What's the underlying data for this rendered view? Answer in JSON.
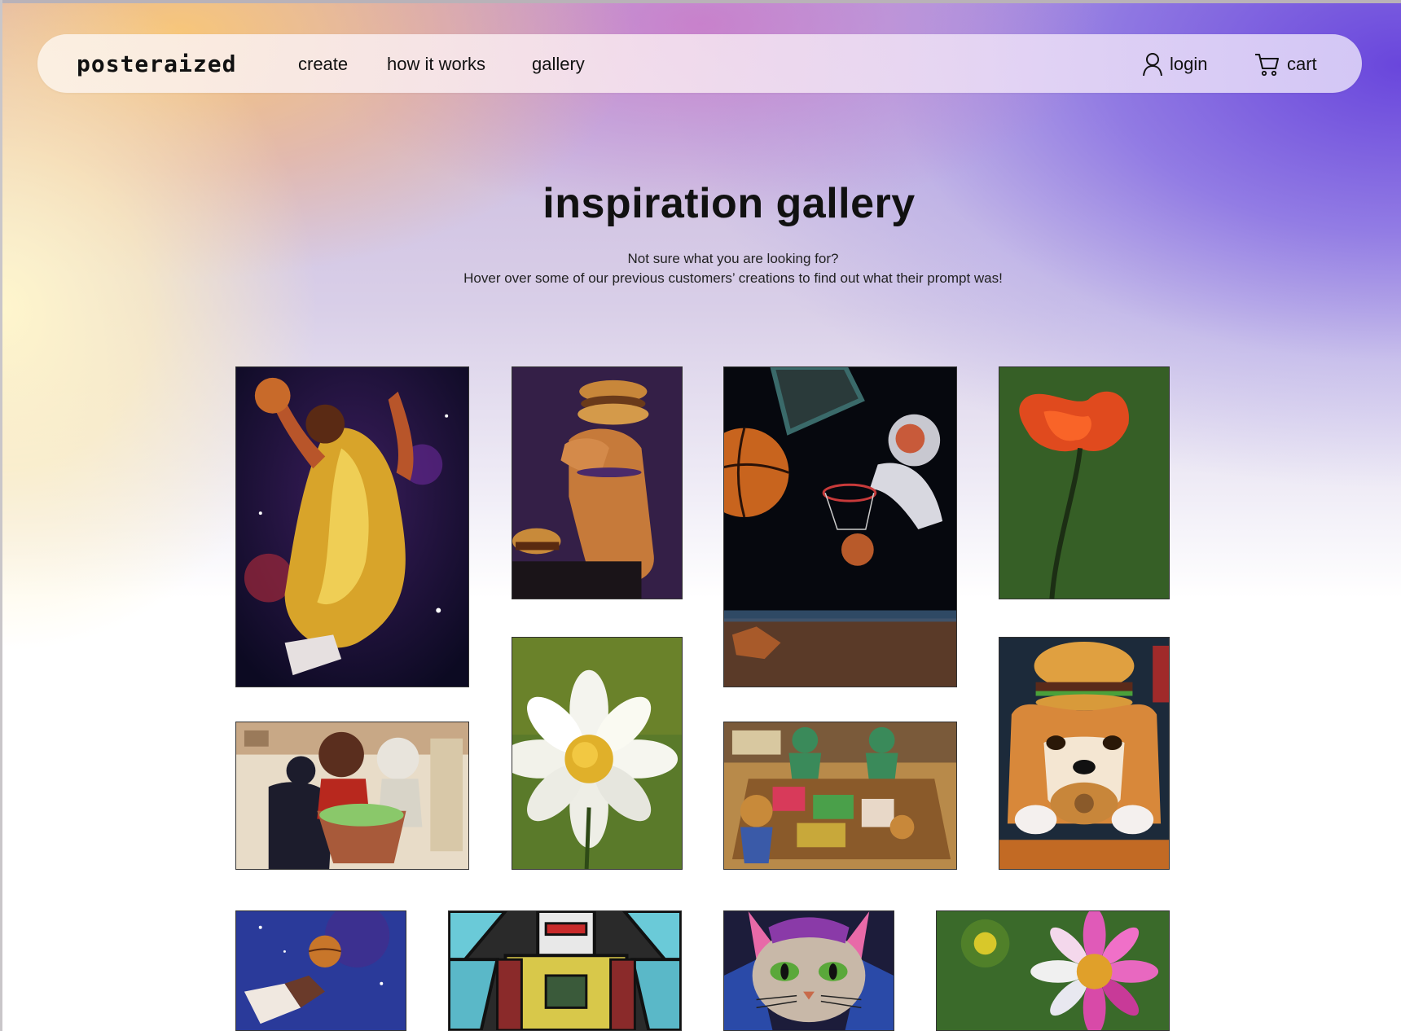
{
  "app": {
    "logo": "posteraized"
  },
  "nav": {
    "links": [
      {
        "label": "create"
      },
      {
        "label": "how it works"
      },
      {
        "label": "gallery"
      }
    ],
    "login_label": "login",
    "cart_label": "cart"
  },
  "hero": {
    "title": "inspiration gallery",
    "subtitle_line1": "Not sure what you are looking for?",
    "subtitle_line2": "Hover over some of our previous customers’ creations to find out what their prompt was!"
  },
  "colors": {
    "accent_purple": "#6b4adf",
    "accent_orange": "#f7c67a",
    "text": "#111111"
  },
  "gallery": {
    "images": [
      {
        "name": "basketball-player-space-painting"
      },
      {
        "name": "shiba-with-burgers-on-head"
      },
      {
        "name": "astronaut-basketball-space"
      },
      {
        "name": "red-flower-painting"
      },
      {
        "name": "white-daisy-painting"
      },
      {
        "name": "shiba-with-burger-hat"
      },
      {
        "name": "teddy-bears-grocery-shopping"
      },
      {
        "name": "teddy-bears-market-stall"
      },
      {
        "name": "space-basketball-painting"
      },
      {
        "name": "stained-glass-robot"
      },
      {
        "name": "angry-cat-drawing"
      },
      {
        "name": "pink-flower-painting"
      }
    ]
  }
}
